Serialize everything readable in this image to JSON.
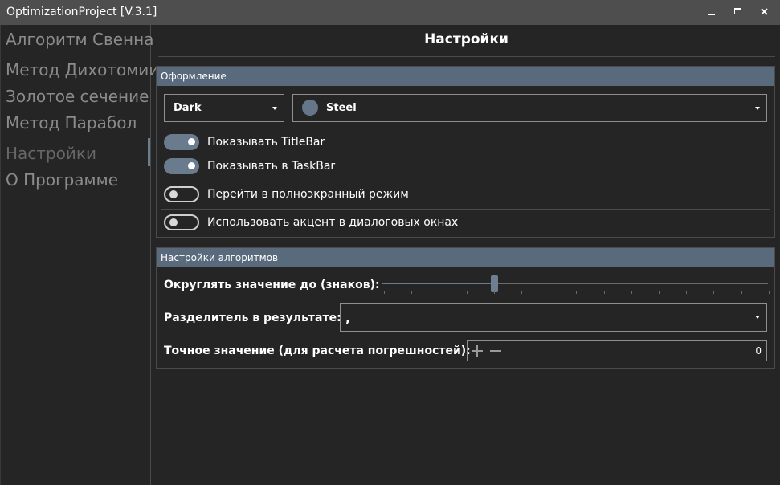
{
  "app": {
    "title": "OptimizationProject [V.3.1]"
  },
  "window_buttons": {
    "minimize_icon": "minimize-icon",
    "maximize_icon": "maximize-icon",
    "close_icon": "close-icon"
  },
  "sidebar": {
    "items": [
      {
        "label": "Алгоритм Свенна"
      },
      {
        "label": "Метод Дихотомии"
      },
      {
        "label": "Золотое сечение"
      },
      {
        "label": "Метод Парабол"
      },
      {
        "label": "Настройки",
        "selected": true
      },
      {
        "label": "О Программе"
      }
    ]
  },
  "page": {
    "title": "Настройки"
  },
  "appearance": {
    "header": "Оформление",
    "theme": {
      "value": "Dark"
    },
    "accent": {
      "value": "Steel",
      "color": "#647687"
    },
    "toggles": [
      {
        "label": "Показывать TitleBar",
        "on": true
      },
      {
        "label": "Показывать в TaskBar",
        "on": true
      },
      {
        "label": "Перейти в полноэкранный режим",
        "on": false
      },
      {
        "label": "Использовать акцент в диалоговых окнах",
        "on": false
      }
    ]
  },
  "algorithm": {
    "header": "Настройки алгоритмов",
    "rounding": {
      "label": "Округлять значение до (знаков):",
      "value_fraction": 0.29
    },
    "separator": {
      "label": "Разделитель в результате:",
      "value": ","
    },
    "exact": {
      "label": "Точное значение (для расчета погрешностей):",
      "value": "0"
    }
  },
  "colors": {
    "accent": "#596a7c",
    "background": "#252525",
    "titlebar": "#4e4e4e"
  }
}
